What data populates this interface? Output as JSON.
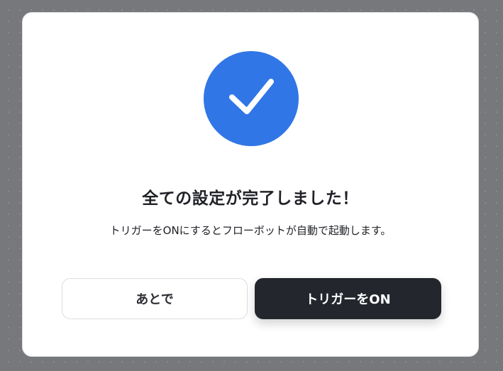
{
  "dialog": {
    "icon": "checkmark-icon",
    "title": "全ての設定が完了しました！",
    "message": "トリガーをONにするとフローボットが自動で起動します。",
    "later_label": "あとで",
    "trigger_on_label": "トリガーをON"
  },
  "colors": {
    "accent": "#3176e6",
    "primary_button": "#23262d",
    "overlay": "#77787b"
  }
}
